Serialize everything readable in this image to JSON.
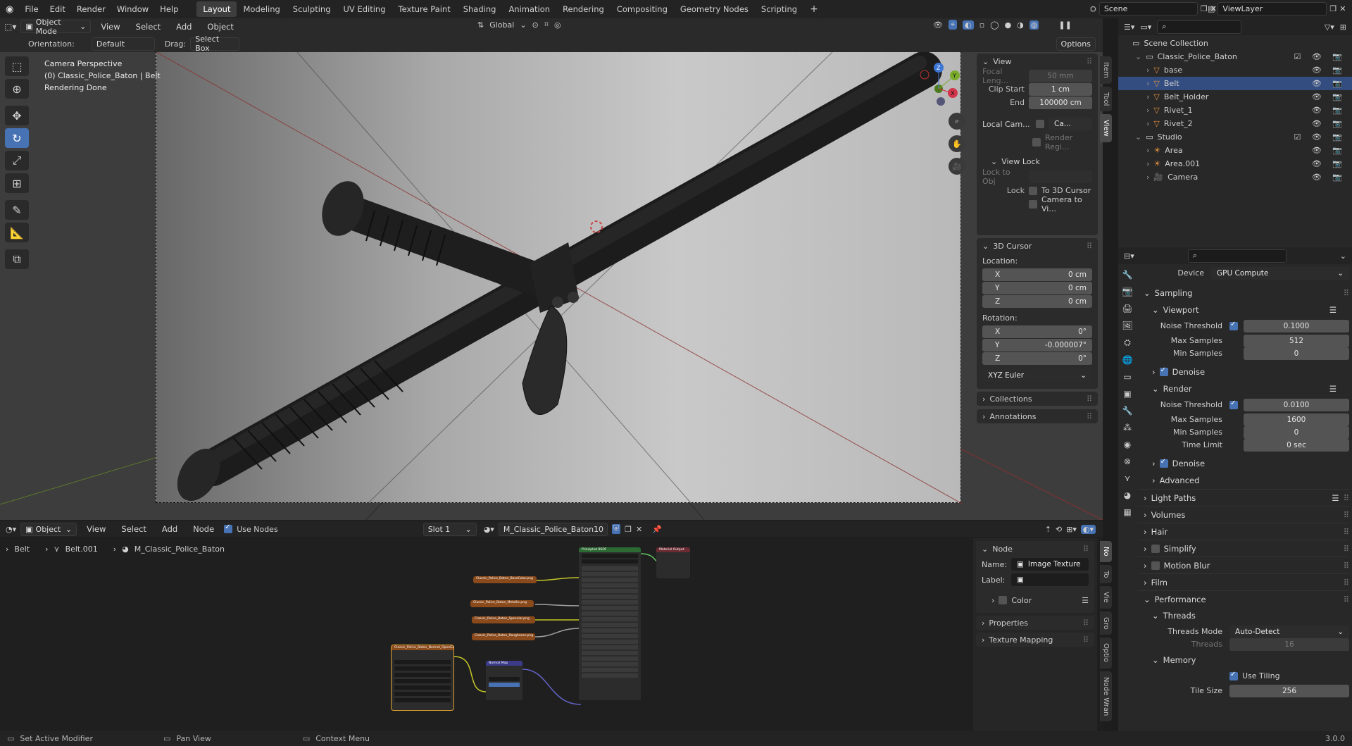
{
  "topbar": {
    "menus": [
      "File",
      "Edit",
      "Render",
      "Window",
      "Help"
    ],
    "workspaces": [
      "Layout",
      "Modeling",
      "Sculpting",
      "UV Editing",
      "Texture Paint",
      "Shading",
      "Animation",
      "Rendering",
      "Compositing",
      "Geometry Nodes",
      "Scripting"
    ],
    "scene": "Scene",
    "viewlayer": "ViewLayer"
  },
  "viewport": {
    "mode": "Object Mode",
    "menus": [
      "View",
      "Select",
      "Add",
      "Object"
    ],
    "orientation": "Global",
    "orientation_label": "Orientation:",
    "orientation_value": "Default",
    "drag_label": "Drag:",
    "drag_value": "Select Box",
    "options": "Options",
    "overlay_lines": [
      "Camera Perspective",
      "(0) Classic_Police_Baton | Belt",
      "Rendering Done"
    ],
    "tabs": [
      "Item",
      "Tool",
      "View"
    ],
    "view_panel": {
      "title": "View",
      "focal_label": "Focal Leng...",
      "focal": "50 mm",
      "clip_start_label": "Clip Start",
      "clip_start": "1 cm",
      "end_label": "End",
      "end": "100000 cm",
      "local_cam_label": "Local Cam...",
      "local_cam_value": "Ca...",
      "render_region": "Render Regi...",
      "view_lock": "View Lock",
      "lock_obj_label": "Lock to Obj",
      "lock_label": "Lock",
      "to_cursor": "To 3D Cursor",
      "camera_to_view": "Camera to Vi..."
    },
    "cursor_panel": {
      "title": "3D Cursor",
      "location": "Location:",
      "loc": [
        {
          "axis": "X",
          "value": "0 cm"
        },
        {
          "axis": "Y",
          "value": "0 cm"
        },
        {
          "axis": "Z",
          "value": "0 cm"
        }
      ],
      "rotation": "Rotation:",
      "rot": [
        {
          "axis": "X",
          "value": "0°"
        },
        {
          "axis": "Y",
          "value": "-0.000007°"
        },
        {
          "axis": "Z",
          "value": "0°"
        }
      ],
      "mode": "XYZ Euler"
    },
    "collections": "Collections",
    "annotations": "Annotations"
  },
  "node_editor": {
    "type": "Object",
    "menus": [
      "View",
      "Select",
      "Add",
      "Node"
    ],
    "use_nodes": "Use Nodes",
    "slot": "Slot 1",
    "material": "M_Classic_Police_Baton",
    "users": "10",
    "breadcrumb": [
      "Belt",
      "Belt.001",
      "M_Classic_Police_Baton"
    ],
    "tabs": [
      "No",
      "To",
      "Vie",
      "Gro",
      "Optio",
      "Node Wran"
    ],
    "node_panel": {
      "title": "Node",
      "name_label": "Name:",
      "name": "Image Texture",
      "label_label": "Label:",
      "color": "Color",
      "properties": "Properties",
      "texture_mapping": "Texture Mapping"
    },
    "nodes": {
      "principled": "Principled BSDF",
      "output": "Material Output",
      "normal_map": "Normal Map",
      "img1": "Classic_Police_Baton_BaseColor.png",
      "img2": "Classic_Police_Baton_Metallic.png",
      "img3": "Classic_Police_Baton_Specular.png",
      "img4": "Classic_Police_Baton_Roughness.png",
      "img5": "Classic_Police_Baton_Normal_OpenGL.png"
    }
  },
  "outliner": {
    "root": "Scene Collection",
    "items": [
      {
        "name": "Classic_Police_Baton",
        "level": 1,
        "type": "collection"
      },
      {
        "name": "base",
        "level": 2,
        "type": "mesh"
      },
      {
        "name": "Belt",
        "level": 2,
        "type": "mesh"
      },
      {
        "name": "Belt_Holder",
        "level": 2,
        "type": "mesh"
      },
      {
        "name": "Rivet_1",
        "level": 2,
        "type": "mesh"
      },
      {
        "name": "Rivet_2",
        "level": 2,
        "type": "mesh"
      },
      {
        "name": "Studio",
        "level": 1,
        "type": "collection"
      },
      {
        "name": "Area",
        "level": 2,
        "type": "light"
      },
      {
        "name": "Area.001",
        "level": 2,
        "type": "light"
      },
      {
        "name": "Camera",
        "level": 2,
        "type": "camera"
      }
    ]
  },
  "properties": {
    "device_label": "Device",
    "device": "GPU Compute",
    "sampling": "Sampling",
    "viewport": "Viewport",
    "noise_label": "Noise Threshold",
    "vp_noise": "0.1000",
    "max_label": "Max Samples",
    "vp_max": "512",
    "min_label": "Min Samples",
    "vp_min": "0",
    "denoise": "Denoise",
    "render": "Render",
    "r_noise": "0.0100",
    "r_max": "1600",
    "r_min": "0",
    "time_label": "Time Limit",
    "time": "0 sec",
    "advanced": "Advanced",
    "light_paths": "Light Paths",
    "volumes": "Volumes",
    "hair": "Hair",
    "simplify": "Simplify",
    "motion_blur": "Motion Blur",
    "film": "Film",
    "performance": "Performance",
    "threads": "Threads",
    "threads_mode_label": "Threads Mode",
    "threads_mode": "Auto-Detect",
    "threads_label": "Threads",
    "threads_value": "16",
    "memory": "Memory",
    "use_tiling": "Use Tiling",
    "tile_label": "Tile Size",
    "tile": "256"
  },
  "status": {
    "left": "Set Active Modifier",
    "mid": "Pan View",
    "right": "Context Menu",
    "version": "3.0.0"
  },
  "colors": {
    "accent": "#4772b3",
    "header": "#232323",
    "panel": "#2b2b2b"
  }
}
